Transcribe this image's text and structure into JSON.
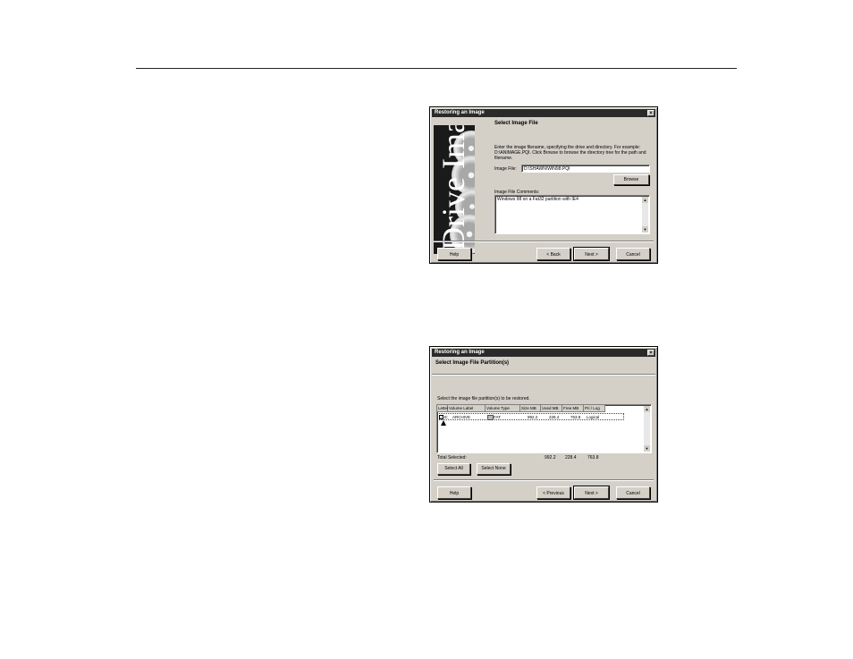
{
  "dialog1": {
    "title": "Restoring an Image",
    "banner": "Drive Image",
    "heading": "Select Image File",
    "instructions_line1": "Enter the image filename, specifying the drive and directory. For example:",
    "instructions_line2": "D:\\ANIMAGE.PQI. Click Browse to browse the directory tree for the path and",
    "instructions_line3": "filename.",
    "image_file_label": "Image File:",
    "image_file_value": "D:\\SHAWN\\WIN98.PQI",
    "browse_label": "Browse",
    "comments_label": "Image File Comments:",
    "comments_value": "Windows 98 on a Fat32 partition with IE4",
    "help_label": "Help",
    "back_label": "< Back",
    "next_label": "Next >",
    "cancel_label": "Cancel"
  },
  "dialog2": {
    "title": "Restoring an Image",
    "heading": "Select Image File Partition(s)",
    "instructions": "Select the image file partition(s) to be restored.",
    "columns": [
      "Letter",
      "Volume Label",
      "Volume Type",
      "Size MB",
      "Used MB",
      "Free MB",
      "Pri / Log"
    ],
    "rows": [
      {
        "letter": "E:",
        "volume_label": "ARCHIVE",
        "volume_type": "FAT",
        "size_mb": "992.2",
        "used_mb": "228.4",
        "free_mb": "763.8",
        "pri_log": "Logical",
        "checked": true
      }
    ],
    "total_label": "Total Selected:",
    "total_size": "992.2",
    "total_used": "228.4",
    "total_free": "763.8",
    "select_all_label": "Select All",
    "select_none_label": "Select None",
    "help_label": "Help",
    "previous_label": "< Previous",
    "next_label": "Next >",
    "cancel_label": "Cancel"
  }
}
